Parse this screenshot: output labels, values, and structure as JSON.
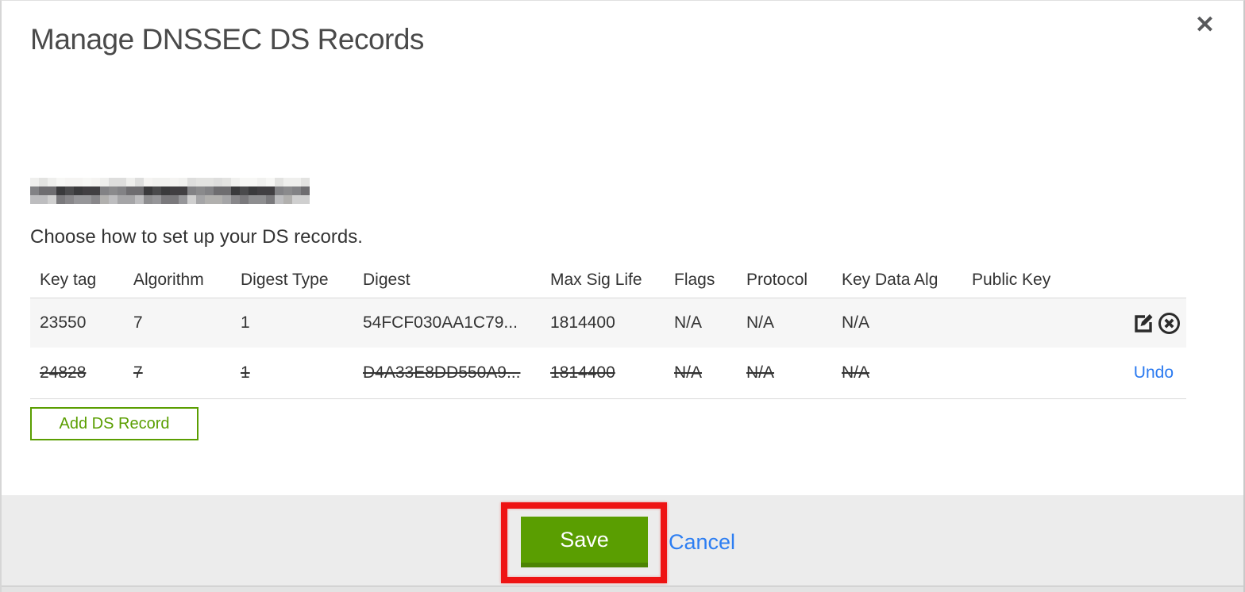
{
  "modal": {
    "title": "Manage DNSSEC DS Records",
    "close_glyph": "✕",
    "instruction": "Choose how to set up your DS records."
  },
  "table": {
    "headers": [
      "Key tag",
      "Algorithm",
      "Digest Type",
      "Digest",
      "Max Sig Life",
      "Flags",
      "Protocol",
      "Key Data Alg",
      "Public Key"
    ],
    "rows": [
      {
        "cells": [
          "23550",
          "7",
          "1",
          "54FCF030AA1C79...",
          "1814400",
          "N/A",
          "N/A",
          "N/A",
          ""
        ],
        "deleted": false,
        "actions": [
          "edit-record",
          "remove-record"
        ]
      },
      {
        "cells": [
          "24828",
          "7",
          "1",
          "D4A33E8DD550A9...",
          "1814400",
          "N/A",
          "N/A",
          "N/A",
          ""
        ],
        "deleted": true,
        "action_label": "Undo"
      }
    ]
  },
  "buttons": {
    "add_ds_record": "Add DS Record",
    "save": "Save",
    "cancel": "Cancel"
  },
  "colors": {
    "accent_green": "#5a9e01",
    "accent_green_dark": "#4c8403",
    "link_blue": "#2d7ef2",
    "annotation_red": "#ee1313",
    "footer_gray": "#ececec",
    "row_gray": "#f6f6f6"
  },
  "redaction": {
    "palettes": [
      [
        "#efefed",
        "#f7f7f5",
        "#e3e3e1",
        "#f1f1ef",
        "#dededd",
        "#f5f4f2"
      ],
      [
        "#3a3a3c",
        "#565558",
        "#2b2b2d",
        "#6e6d70",
        "#4a4a4c",
        "#828285",
        "#99948e",
        "#5b5a5e",
        "#413f42",
        "#8a8a8c"
      ],
      [
        "#a5a5a7",
        "#8e8e90",
        "#bdbdbf",
        "#7a797c",
        "#cfcfcf",
        "#969699",
        "#b1b0ae",
        "#88878a"
      ]
    ]
  }
}
